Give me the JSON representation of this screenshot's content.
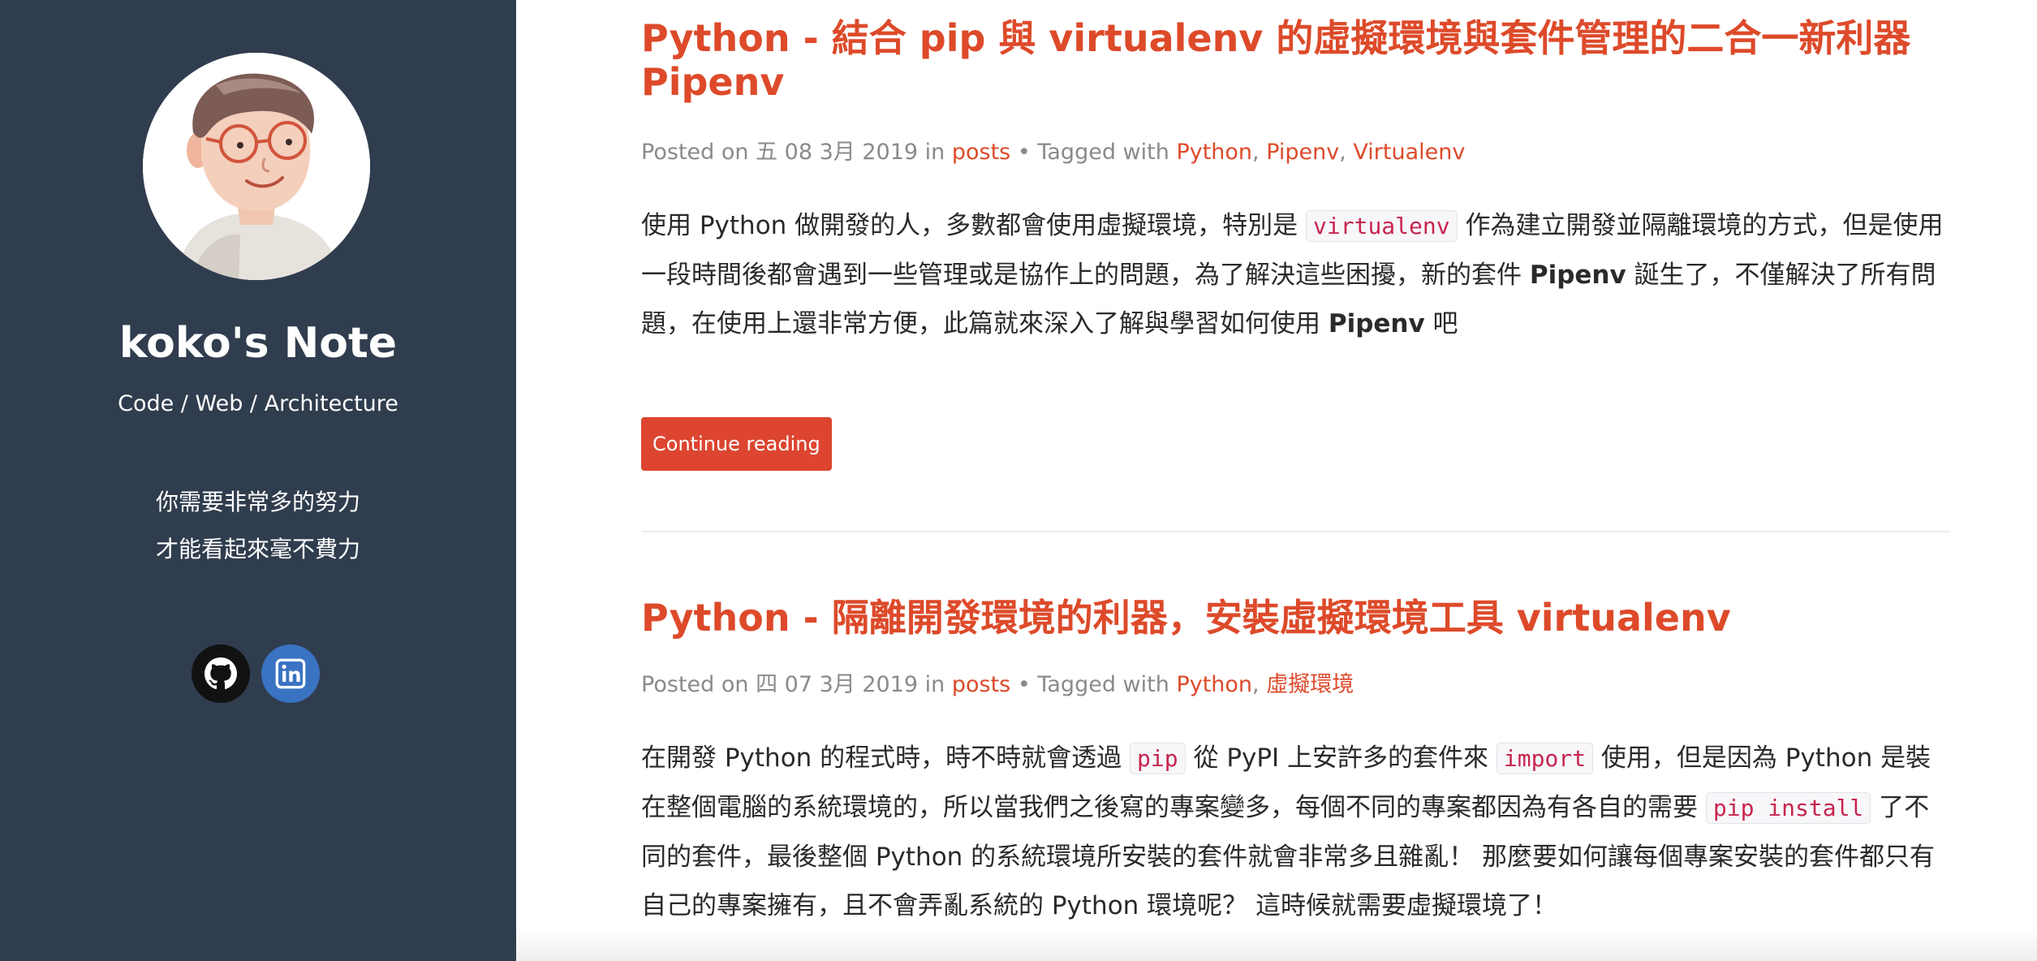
{
  "sidebar": {
    "site_title": "koko's Note",
    "site_subtitle": "Code / Web / Architecture",
    "motto_line1": "你需要非常多的努力",
    "motto_line2": "才能看起來毫不費力",
    "socials": [
      {
        "name": "github",
        "icon": "github-icon"
      },
      {
        "name": "linkedin",
        "icon": "linkedin-icon"
      }
    ]
  },
  "posts": [
    {
      "title": "Python - 結合 pip 與 virtualenv 的虛擬環境與套件管理的二合一新利器 Pipenv",
      "meta": {
        "posted_on": "Posted on",
        "date": "五 08 3月 2019",
        "in": "in",
        "category": "posts",
        "tagged_with": "• Tagged with",
        "tags": [
          "Python",
          "Pipenv",
          "Virtualenv"
        ]
      },
      "summary": {
        "t1": "使用 Python 做開發的人，多數都會使用虛擬環境，特別是 ",
        "c1": "virtualenv",
        "t2": " 作為建立開發並隔離環境的方式，但是使用一段時間後都會遇到一些管理或是協作上的問題，為了解決這些困擾，新的套件 ",
        "b1": "Pipenv",
        "t3": " 誕生了，不僅解決了所有問題，在使用上還非常方便，此篇就來深入了解與學習如何使用 ",
        "b2": "Pipenv",
        "t4": " 吧"
      },
      "continue_label": "Continue reading"
    },
    {
      "title": "Python - 隔離開發環境的利器，安裝虛擬環境工具 virtualenv",
      "meta": {
        "posted_on": "Posted on",
        "date": "四 07 3月 2019",
        "in": "in",
        "category": "posts",
        "tagged_with": "• Tagged with",
        "tags": [
          "Python",
          "虛擬環境"
        ]
      },
      "summary": {
        "t1": "在開發 Python 的程式時，時不時就會透過 ",
        "c1": "pip",
        "t2": " 從 PyPI 上安許多的套件來 ",
        "c2": "import",
        "t3": " 使用，但是因為 Python 是裝在整個電腦的系統環境的，所以當我們之後寫的專案變多，每個不同的專案都因為有各自的需要 ",
        "c3": "pip install",
        "t4": " 了不同的套件，最後整個 Python 的系統環境所安裝的套件就會非常多且雜亂！ 那麼要如何讓每個專案安裝的套件都只有自己的專案擁有，且不會弄亂系統的 Python 環境呢？ 這時候就需要虛擬環境了！"
      }
    }
  ],
  "colors": {
    "sidebar_bg": "#303d4e",
    "accent": "#dd4a2a",
    "meta_text": "#8a8a8a",
    "body_text": "#2a2a2a",
    "code_text": "#c7254e"
  }
}
